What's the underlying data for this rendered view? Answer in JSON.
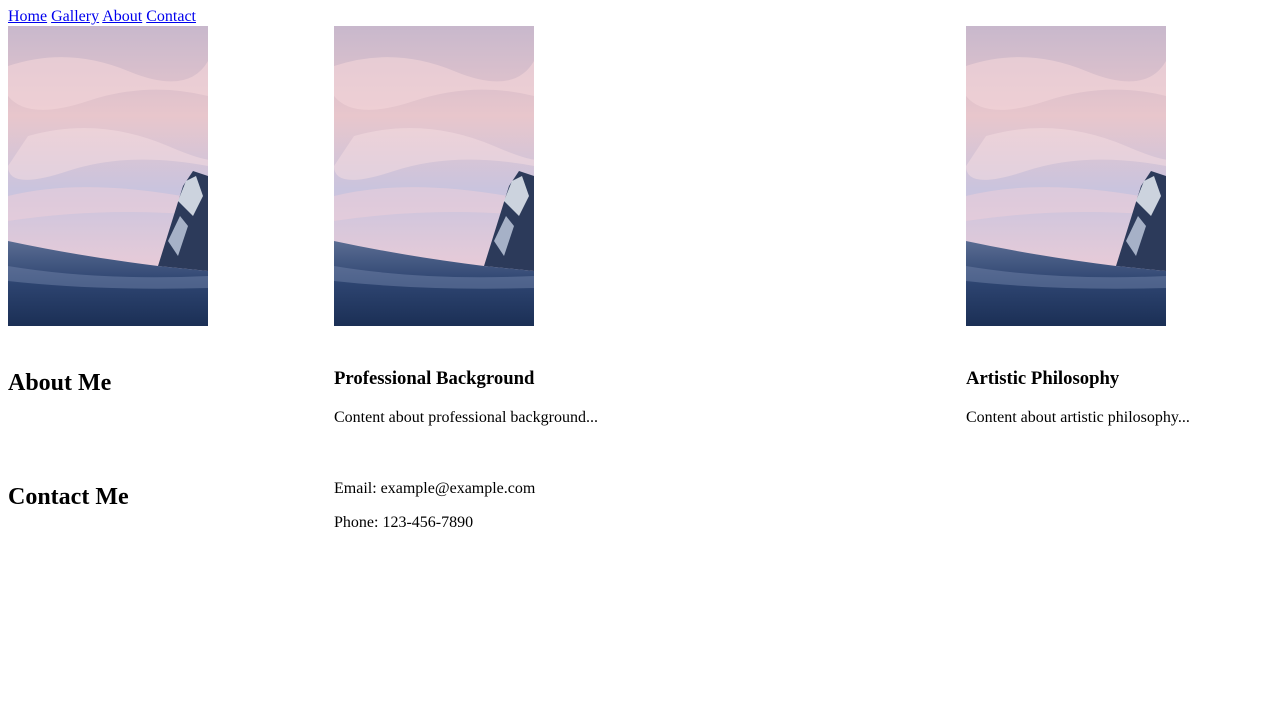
{
  "nav": {
    "links": [
      "Home",
      "Gallery",
      "About",
      "Contact"
    ]
  },
  "gallery": {
    "images": [
      {
        "icon": "mountain-sunset-photo"
      },
      {
        "icon": "mountain-sunset-photo"
      },
      {
        "icon": "mountain-sunset-photo"
      }
    ]
  },
  "about": {
    "title": "About Me",
    "background": {
      "heading": "Professional Background",
      "text": "Content about professional background..."
    },
    "philosophy": {
      "heading": "Artistic Philosophy",
      "text": "Content about artistic philosophy..."
    }
  },
  "contact": {
    "title": "Contact Me",
    "email": "Email: example@example.com",
    "phone": "Phone: 123-456-7890"
  },
  "colors": {
    "link": "#0000ee",
    "text": "#000000",
    "background": "#ffffff"
  }
}
